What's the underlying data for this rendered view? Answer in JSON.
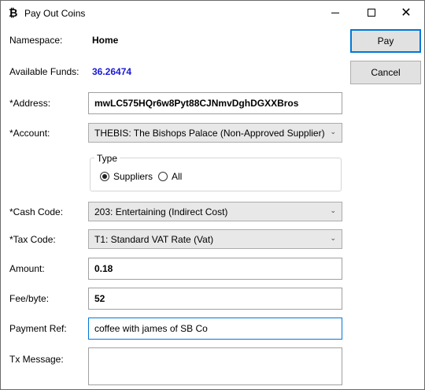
{
  "window": {
    "title": "Pay Out Coins",
    "icon": "bitcoin-icon",
    "icon_glyph": "₿",
    "min_label": "",
    "max_label": "",
    "close_glyph": "✕"
  },
  "namespace": {
    "label": "Namespace:",
    "value": "Home"
  },
  "funds": {
    "label": "Available Funds:",
    "value": "36.26474",
    "color": "#1a1ad6"
  },
  "address": {
    "label": "*Address:",
    "value": "mwLC575HQr6w8Pyt88CJNmvDghDGXXBros"
  },
  "account": {
    "label": "*Account:",
    "selected": "THEBIS: The Bishops Palace (Non-Approved Supplier)"
  },
  "type_group": {
    "legend": "Type",
    "options": [
      {
        "label": "Suppliers",
        "checked": true
      },
      {
        "label": "All",
        "checked": false
      }
    ]
  },
  "cash_code": {
    "label": "*Cash Code:",
    "selected": "203: Entertaining (Indirect Cost)"
  },
  "tax_code": {
    "label": "*Tax Code:",
    "selected": "T1: Standard VAT Rate (Vat)"
  },
  "amount": {
    "label": "Amount:",
    "value": "0.18"
  },
  "fee": {
    "label": "Fee/byte:",
    "value": "52"
  },
  "payment_ref": {
    "label": "Payment Ref:",
    "value": "coffee with james of SB Co"
  },
  "tx_message": {
    "label": "Tx Message:",
    "value": ""
  },
  "buttons": {
    "pay": "Pay",
    "cancel": "Cancel"
  }
}
